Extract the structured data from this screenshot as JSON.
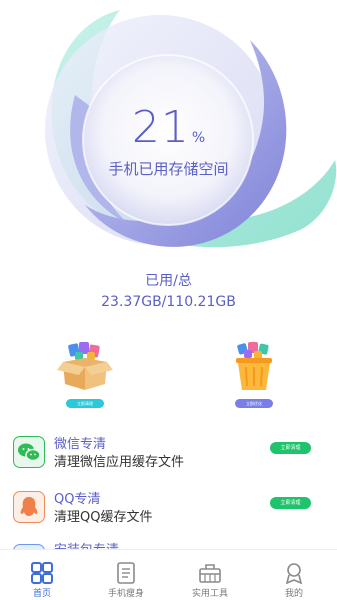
{
  "storage": {
    "percent": "21",
    "percent_unit": "%",
    "label": "手机已用存储空间",
    "used_title": "已用/总",
    "used_value": "23.37GB/110.21GB",
    "used_fraction": 0.21
  },
  "tools": [
    {
      "icon": "box-icon",
      "label": "立即清理"
    },
    {
      "icon": "trash-bin-icon",
      "label": "立即优化"
    }
  ],
  "list": [
    {
      "icon": "wechat-icon",
      "title": "微信专清",
      "desc": "清理微信应用缓存文件",
      "button": "立即清理"
    },
    {
      "icon": "qq-icon",
      "title": "QQ专清",
      "desc": "清理QQ缓存文件",
      "button": "立即清理"
    },
    {
      "icon": "package-icon",
      "title": "安装包专清"
    }
  ],
  "tabbar": [
    {
      "icon": "grid-icon",
      "label": "首页",
      "active": true
    },
    {
      "icon": "phone-slim-icon",
      "label": "手机瘦身",
      "active": false
    },
    {
      "icon": "toolbox-icon",
      "label": "实用工具",
      "active": false
    },
    {
      "icon": "profile-icon",
      "label": "我的",
      "active": false
    }
  ],
  "colors": {
    "accent": "#5a5fc8",
    "green": "#1ec46b",
    "tab_active": "#3d6fd6",
    "teal": "#7fdcc8",
    "purple": "#8b8ee0"
  }
}
